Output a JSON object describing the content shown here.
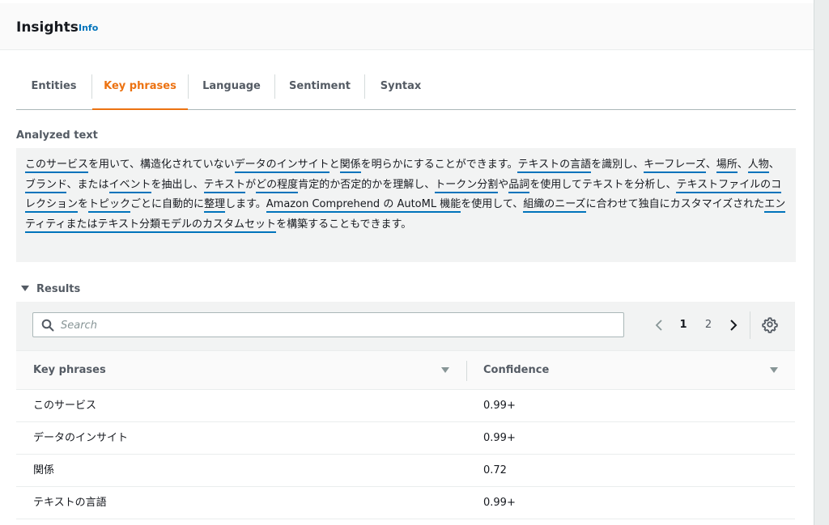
{
  "header": {
    "title": "Insights",
    "info": "Info"
  },
  "tabs": [
    {
      "label": "Entities"
    },
    {
      "label": "Key phrases"
    },
    {
      "label": "Language"
    },
    {
      "label": "Sentiment"
    },
    {
      "label": "Syntax"
    }
  ],
  "active_tab": "Key phrases",
  "analyzed": {
    "label": "Analyzed text",
    "segments": [
      {
        "t": "このサービス",
        "kp": true
      },
      {
        "t": "を用いて、構造化されていない",
        "kp": false
      },
      {
        "t": "データのインサイト",
        "kp": true
      },
      {
        "t": "と",
        "kp": false
      },
      {
        "t": "関係",
        "kp": true
      },
      {
        "t": "を明らかにすることができます。",
        "kp": false
      },
      {
        "t": "テキストの言語",
        "kp": true
      },
      {
        "t": "を識別し、",
        "kp": false
      },
      {
        "t": "キーフレーズ",
        "kp": true
      },
      {
        "t": "、",
        "kp": false
      },
      {
        "t": "場所",
        "kp": true
      },
      {
        "t": "、",
        "kp": false
      },
      {
        "t": "人物",
        "kp": true
      },
      {
        "t": "、",
        "kp": false
      },
      {
        "t": "ブランド",
        "kp": true
      },
      {
        "t": "、または",
        "kp": false
      },
      {
        "t": "イベント",
        "kp": true
      },
      {
        "t": "を抽出し、",
        "kp": false
      },
      {
        "t": "テキスト",
        "kp": true
      },
      {
        "t": "が",
        "kp": false
      },
      {
        "t": "どの程度",
        "kp": true
      },
      {
        "t": "肯定的か否定的かを理解し、",
        "kp": false
      },
      {
        "t": "トークン分割",
        "kp": true
      },
      {
        "t": "や",
        "kp": false
      },
      {
        "t": "品詞",
        "kp": true
      },
      {
        "t": "を使用してテキストを分析し、",
        "kp": false
      },
      {
        "t": "テキストファイルのコレクション",
        "kp": true
      },
      {
        "t": "を",
        "kp": false
      },
      {
        "t": "トピック",
        "kp": true
      },
      {
        "t": "ごとに自動的に",
        "kp": false
      },
      {
        "t": "整理",
        "kp": true
      },
      {
        "t": "します。",
        "kp": false
      },
      {
        "t": "Amazon Comprehend の AutoML 機能",
        "kp": true
      },
      {
        "t": "を使用して、",
        "kp": false
      },
      {
        "t": "組織のニーズ",
        "kp": true
      },
      {
        "t": "に合わせて独自にカスタマイズされた",
        "kp": false
      },
      {
        "t": "エンティティまたはテキスト分類モデルのカスタムセット",
        "kp": true
      },
      {
        "t": "を構築することもできます。",
        "kp": false
      }
    ]
  },
  "results": {
    "label": "Results",
    "search_placeholder": "Search",
    "pages": [
      "1",
      "2"
    ],
    "current_page": "1",
    "columns": [
      "Key phrases",
      "Confidence"
    ],
    "rows": [
      {
        "phrase": "このサービス",
        "confidence": "0.99+"
      },
      {
        "phrase": "データのインサイト",
        "confidence": "0.99+"
      },
      {
        "phrase": "関係",
        "confidence": "0.72"
      },
      {
        "phrase": "テキストの言語",
        "confidence": "0.99+"
      }
    ]
  },
  "colors": {
    "accent": "#ec7211",
    "link": "#0073bb",
    "underline": "#0073bb"
  },
  "icons": [
    "search-icon",
    "chevron-left-icon",
    "chevron-right-icon",
    "gear-icon",
    "caret-down-icon",
    "sort-icon"
  ]
}
